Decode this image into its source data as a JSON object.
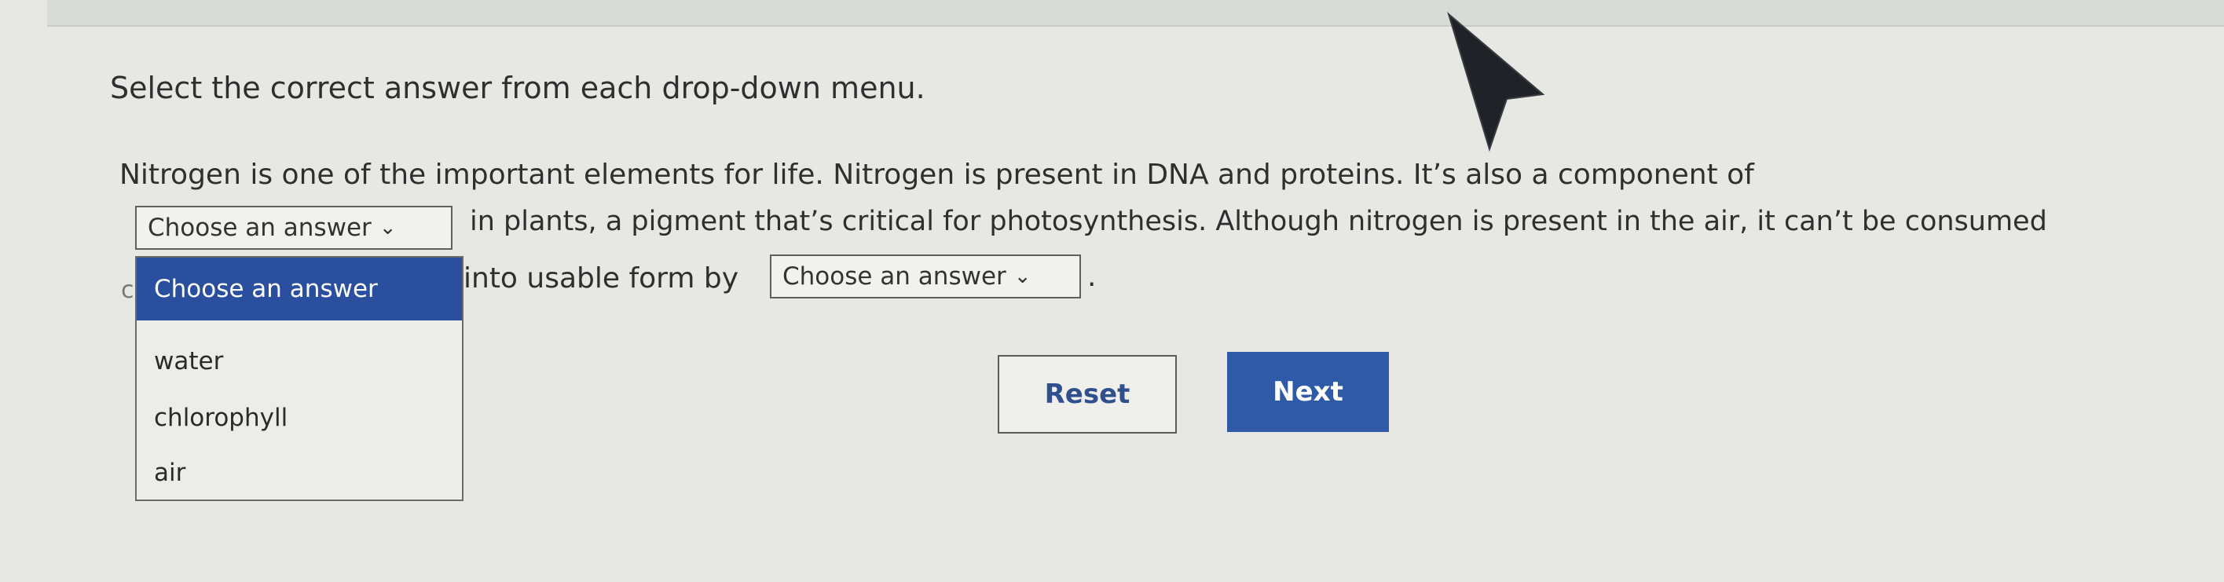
{
  "instruction": "Select the correct answer from each drop-down menu.",
  "question": {
    "line1": "Nitrogen is one of the important elements for life. Nitrogen is present in DNA and proteins. It’s also a component of",
    "line2": "in plants, a pigment that’s critical for photosynthesis. Although nitrogen is present in the air, it can’t be consumed",
    "line3": "into usable form by",
    "period": "."
  },
  "dropdown1": {
    "selected": "Choose an answer",
    "options": [
      "Choose an answer",
      "water",
      "chlorophyll",
      "air"
    ]
  },
  "dropdown2": {
    "selected": "Choose an answer"
  },
  "buttons": {
    "reset": "Reset",
    "next": "Next"
  },
  "colors": {
    "accent": "#2f5aa8",
    "highlight": "#2a4f9e"
  },
  "icons": {
    "chevron": "chevron-down-icon",
    "cursor": "mouse-pointer-icon"
  }
}
